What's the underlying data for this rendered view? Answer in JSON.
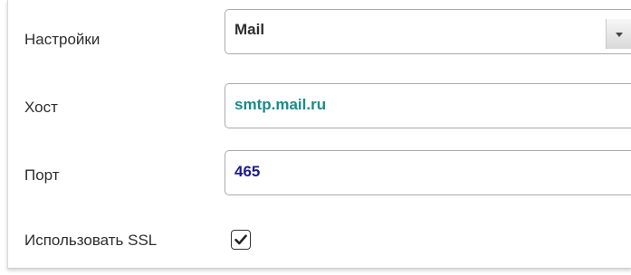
{
  "settings": {
    "label": "Настройки",
    "value": "Mail"
  },
  "host": {
    "label": "Хост",
    "value": "smtp.mail.ru",
    "color": "#1a8a8a"
  },
  "port": {
    "label": "Порт",
    "value": "465",
    "color": "#1a1a8c"
  },
  "ssl": {
    "label": "Использовать SSL",
    "checked": true,
    "icon": "checkmark-icon"
  }
}
